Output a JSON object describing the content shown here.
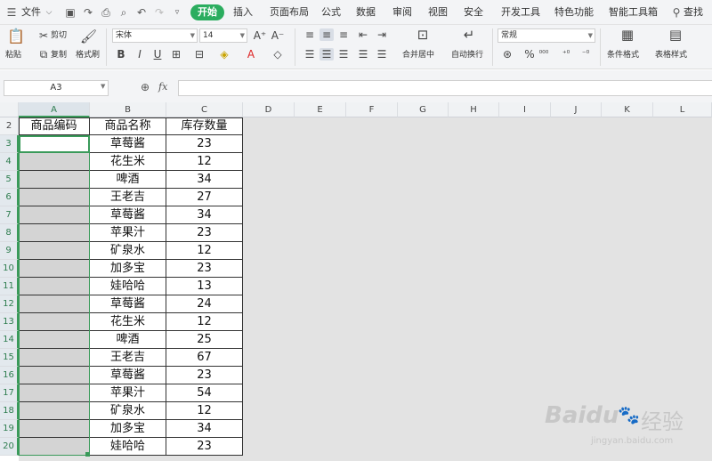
{
  "menu": {
    "file": "文件",
    "tabs": [
      "开始",
      "插入",
      "页面布局",
      "公式",
      "数据",
      "审阅",
      "视图",
      "安全",
      "开发工具",
      "特色功能",
      "智能工具箱"
    ],
    "search": "查找"
  },
  "ribbon": {
    "paste": "粘贴",
    "cut": "剪切",
    "copy": "复制",
    "format_painter": "格式刷",
    "font_name": "宋体",
    "font_size": "14",
    "merge_center": "合并居中",
    "wrap_text": "自动换行",
    "number_format": "常规",
    "conditional_format": "条件格式",
    "table_style": "表格样式"
  },
  "formula_bar": {
    "name_box": "A3",
    "fx": "fx",
    "formula": ""
  },
  "sheet": {
    "columns": [
      "A",
      "B",
      "C",
      "D",
      "E",
      "F",
      "G",
      "H",
      "I",
      "J",
      "K",
      "L"
    ],
    "row_numbers": [
      "2",
      "3",
      "4",
      "5",
      "6",
      "7",
      "8",
      "9",
      "10",
      "11",
      "12",
      "13",
      "14",
      "15",
      "16",
      "17",
      "18",
      "19",
      "20"
    ],
    "header": {
      "a": "商品编码",
      "b": "商品名称",
      "c": "库存数量"
    },
    "rows": [
      {
        "b": "草莓酱",
        "c": "23"
      },
      {
        "b": "花生米",
        "c": "12"
      },
      {
        "b": "啤酒",
        "c": "34"
      },
      {
        "b": "王老吉",
        "c": "27"
      },
      {
        "b": "草莓酱",
        "c": "34"
      },
      {
        "b": "苹果汁",
        "c": "23"
      },
      {
        "b": "矿泉水",
        "c": "12"
      },
      {
        "b": "加多宝",
        "c": "23"
      },
      {
        "b": "娃哈哈",
        "c": "13"
      },
      {
        "b": "草莓酱",
        "c": "24"
      },
      {
        "b": "花生米",
        "c": "12"
      },
      {
        "b": "啤酒",
        "c": "25"
      },
      {
        "b": "王老吉",
        "c": "67"
      },
      {
        "b": "草莓酱",
        "c": "23"
      },
      {
        "b": "苹果汁",
        "c": "54"
      },
      {
        "b": "矿泉水",
        "c": "12"
      },
      {
        "b": "加多宝",
        "c": "34"
      },
      {
        "b": "娃哈哈",
        "c": "23"
      }
    ]
  },
  "watermark": {
    "brand": "Baidu",
    "cn": "经验",
    "url": "jingyan.baidu.com"
  },
  "colors": {
    "accent": "#2bad5f",
    "selection": "#3a9a5a",
    "cell_fill": "#d4d4d4"
  }
}
